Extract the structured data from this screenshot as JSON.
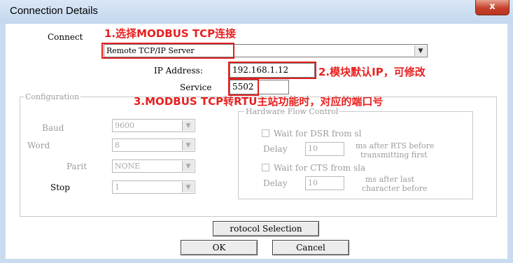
{
  "window": {
    "title": "Connection Details",
    "close_glyph": "x"
  },
  "connect": {
    "label": "Connect",
    "value": "Remote TCP/IP Server",
    "annotation": "1.选择MODBUS TCP连接"
  },
  "ip": {
    "label": "IP Address:",
    "value": "192.168.1.12",
    "annotation": "2.模块默认IP，可修改"
  },
  "service": {
    "label": "Service",
    "value": "5502",
    "annotation": "3.MODBUS TCP转RTU主站功能时，对应的端口号"
  },
  "configuration": {
    "title": "Configuration",
    "baud": {
      "label": "Baud",
      "value": "9600"
    },
    "word": {
      "label": "Word",
      "value": "8"
    },
    "parity": {
      "label": "Parit",
      "value": "NONE"
    },
    "stop": {
      "label": "Stop",
      "value": "1"
    }
  },
  "flow_control": {
    "title": "Hardware Flow Control",
    "dsr": {
      "label": "Wait for DSR from sl",
      "delay_label": "Delay",
      "delay_value": "10",
      "note_line1": "ms after RTS before",
      "note_line2": "transmitting first"
    },
    "cts": {
      "label": "Wait for CTS from sla",
      "delay_label": "Delay",
      "delay_value": "10",
      "note_line1": "ms after last",
      "note_line2": "character before"
    }
  },
  "buttons": {
    "protocol": "rotocol Selection",
    "ok": "OK",
    "cancel": "Cancel"
  }
}
